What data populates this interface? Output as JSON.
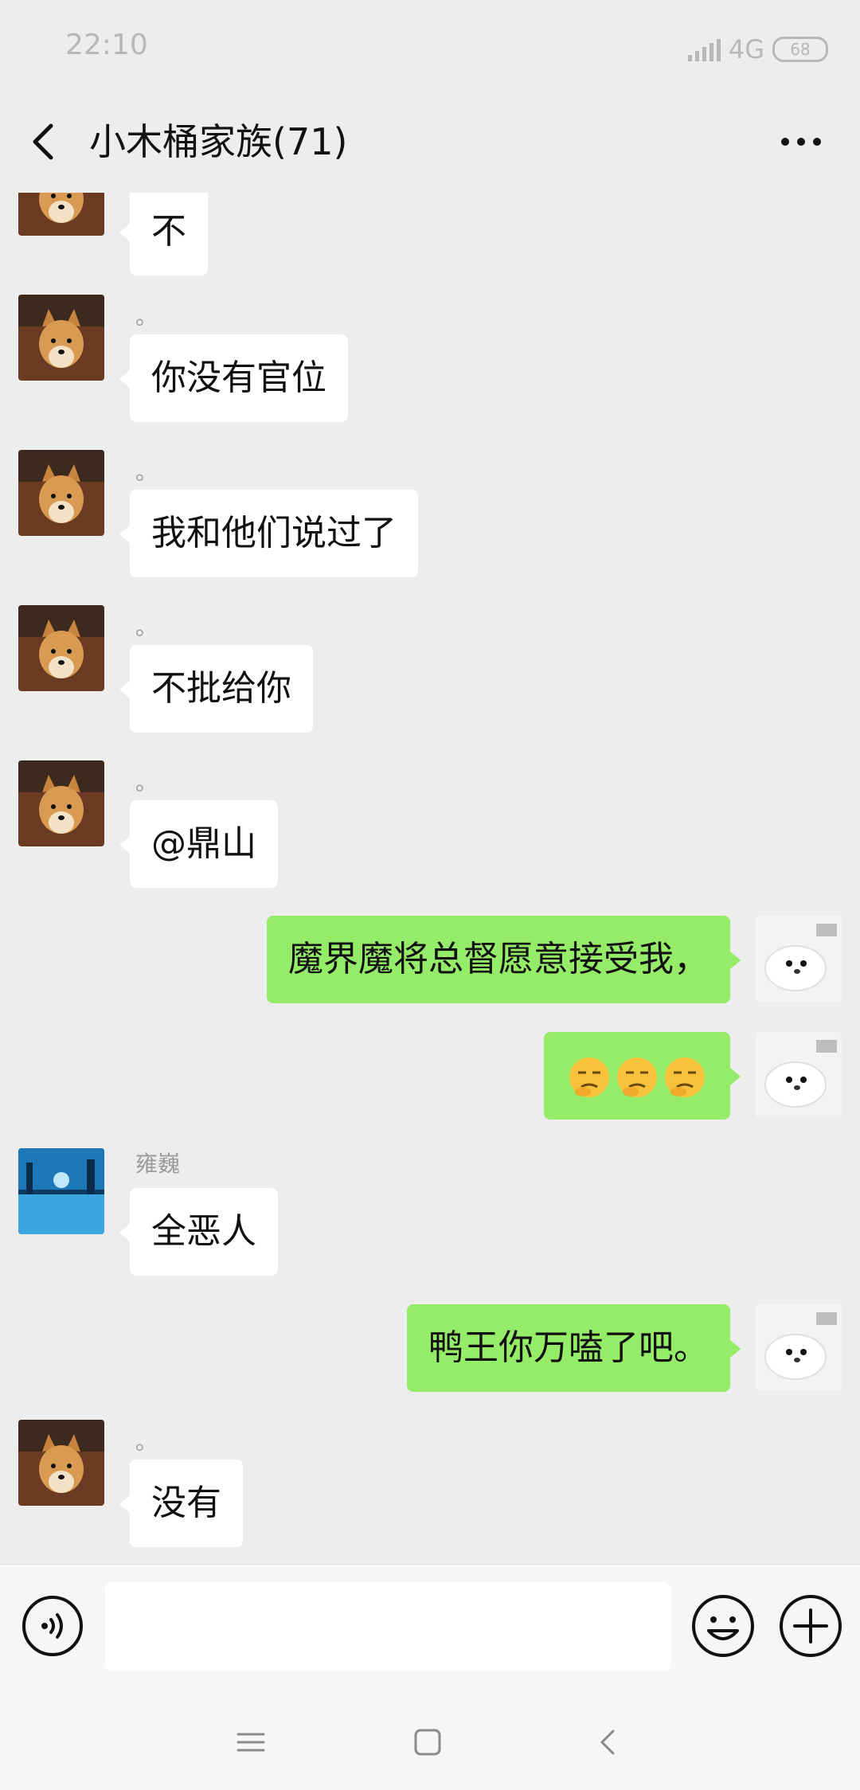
{
  "status_bar": {
    "time": "22:10",
    "network": "4G",
    "battery": "68"
  },
  "header": {
    "title": "小木桶家族(71)"
  },
  "messages": [
    {
      "side": "left",
      "avatar": "shiba-dog",
      "sender": "",
      "text": "不"
    },
    {
      "side": "left",
      "avatar": "shiba-dog",
      "sender": "。",
      "text": "你没有官位"
    },
    {
      "side": "left",
      "avatar": "shiba-dog",
      "sender": "。",
      "text": "我和他们说过了"
    },
    {
      "side": "left",
      "avatar": "shiba-dog",
      "sender": "。",
      "text": "不批给你"
    },
    {
      "side": "left",
      "avatar": "shiba-dog",
      "sender": "。",
      "text": "@鼎山"
    },
    {
      "side": "right",
      "avatar": "white-seal",
      "text": "魔界魔将总督愿意接受我，"
    },
    {
      "side": "right",
      "avatar": "white-seal",
      "emoji": [
        "thinking-face",
        "thinking-face",
        "thinking-face"
      ]
    },
    {
      "side": "left",
      "avatar": "city-night",
      "sender": "雍巍",
      "text": "全恶人"
    },
    {
      "side": "right",
      "avatar": "white-seal",
      "text": "鸭王你万嗑了吧。"
    },
    {
      "side": "left",
      "avatar": "shiba-dog",
      "sender": "。",
      "text": "没有"
    }
  ],
  "input": {
    "placeholder": ""
  },
  "colors": {
    "self_bubble": "#95ec69",
    "other_bubble": "#ffffff",
    "background": "#ededed"
  }
}
